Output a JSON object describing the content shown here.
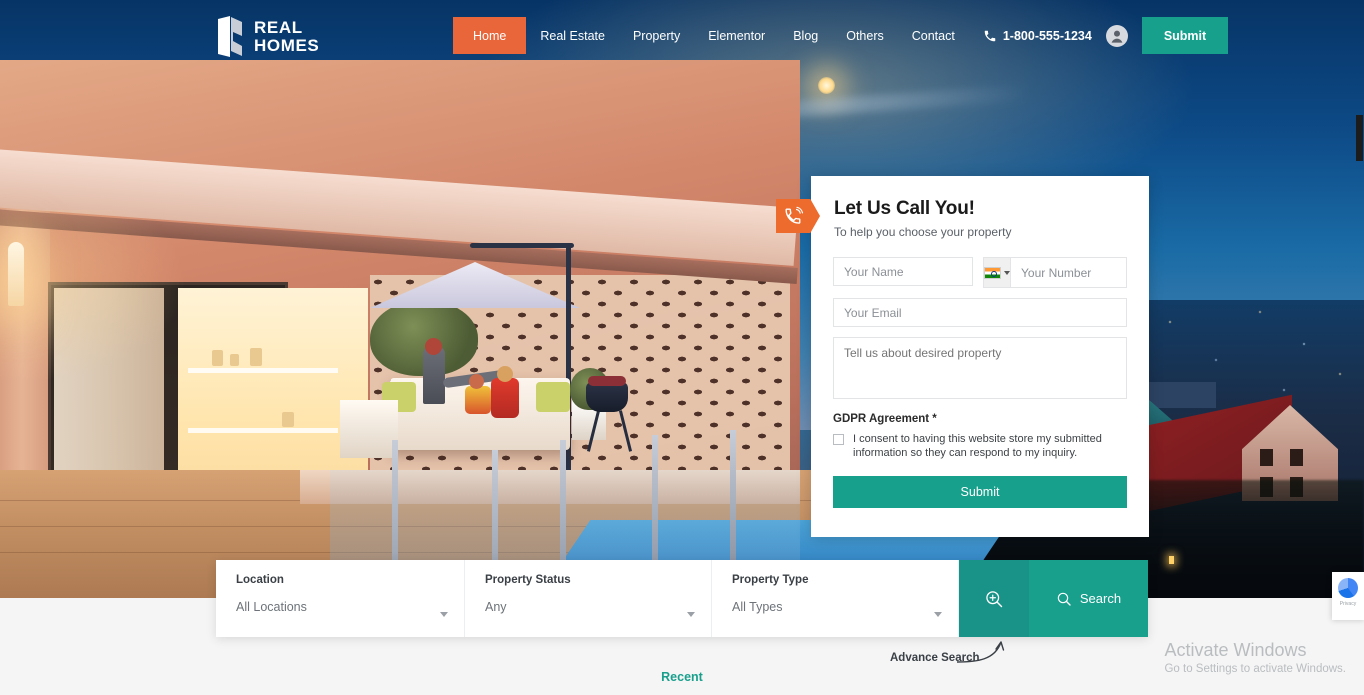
{
  "brand": {
    "name_line1": "REAL",
    "name_line2": "HOMES",
    "logo_icon": "house-monogram-icon"
  },
  "header": {
    "nav": [
      {
        "label": "Home",
        "active": true
      },
      {
        "label": "Real Estate",
        "active": false
      },
      {
        "label": "Property",
        "active": false
      },
      {
        "label": "Elementor",
        "active": false
      },
      {
        "label": "Blog",
        "active": false
      },
      {
        "label": "Others",
        "active": false
      },
      {
        "label": "Contact",
        "active": false
      }
    ],
    "phone": "1-800-555-1234",
    "phone_icon": "phone-icon",
    "account_icon": "user-account-icon",
    "submit_label": "Submit",
    "accent_active": "#e8663a",
    "accent_teal": "#17a08c"
  },
  "callback_form": {
    "tab_icon": "phone-ring-icon",
    "title": "Let Us Call You!",
    "subtitle": "To help you choose your property",
    "name_placeholder": "Your Name",
    "country_flag": "india-flag-icon",
    "number_placeholder": "Your Number",
    "email_placeholder": "Your Email",
    "message_placeholder": "Tell us about desired property",
    "gdpr_label": "GDPR Agreement *",
    "gdpr_text": "I consent to having this website store my submitted information so they can respond to my inquiry.",
    "gdpr_checked": false,
    "submit_label": "Submit"
  },
  "search": {
    "fields": [
      {
        "label": "Location",
        "value": "All Locations"
      },
      {
        "label": "Property Status",
        "value": "Any"
      },
      {
        "label": "Property Type",
        "value": "All Types"
      }
    ],
    "advance_icon": "magnifier-plus-icon",
    "search_icon": "search-icon",
    "search_label": "Search",
    "advance_note": "Advance Search"
  },
  "below": {
    "recent_label": "Recent"
  },
  "watermark": {
    "line1": "Activate Windows",
    "line2": "Go to Settings to activate Windows."
  },
  "recaptcha": {
    "label": "Privacy"
  }
}
